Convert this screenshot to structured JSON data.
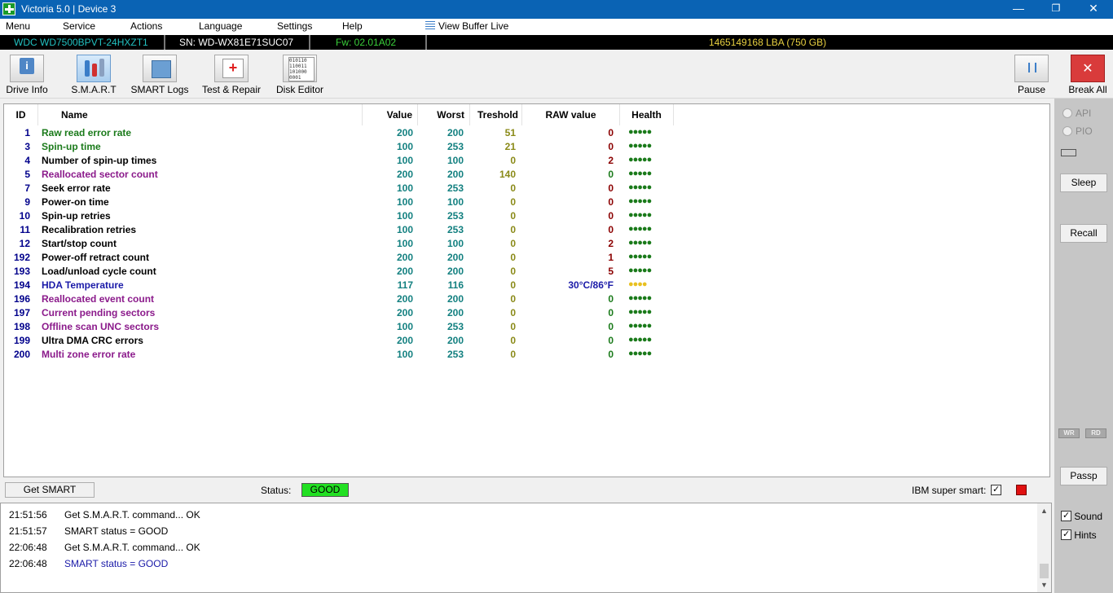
{
  "window": {
    "title": "Victoria 5.0 | Device 3",
    "min": "—",
    "max": "❐",
    "close": "✕"
  },
  "menu": {
    "items": [
      "Menu",
      "Service",
      "Actions",
      "Language",
      "Settings",
      "Help"
    ],
    "view_buffer": "View Buffer Live"
  },
  "drive": {
    "model": "WDC WD7500BPVT-24HXZT1",
    "serial": "SN: WD-WX81E71SUC07",
    "firmware": "Fw: 02.01A02",
    "capacity": "1465149168 LBA (750 GB)"
  },
  "toolbar": {
    "drive_info": "Drive Info",
    "smart": "S.M.A.R.T",
    "smart_logs": "SMART Logs",
    "test_repair": "Test & Repair",
    "disk_editor": "Disk Editor",
    "pause": "Pause",
    "break_all": "Break All"
  },
  "table": {
    "headers": {
      "id": "ID",
      "name": "Name",
      "value": "Value",
      "worst": "Worst",
      "threshold": "Treshold",
      "raw": "RAW value",
      "health": "Health"
    },
    "rows": [
      {
        "id": "1",
        "name": "Raw read error rate",
        "value": "200",
        "worst": "200",
        "threshold": "51",
        "raw": "0",
        "health": "●●●●●",
        "name_color": "#1a7a1a",
        "raw_color": "#8b0000",
        "health_color": "#1a7a1a"
      },
      {
        "id": "3",
        "name": "Spin-up time",
        "value": "100",
        "worst": "253",
        "threshold": "21",
        "raw": "0",
        "health": "●●●●●",
        "name_color": "#1a7a1a",
        "raw_color": "#8b0000",
        "health_color": "#1a7a1a"
      },
      {
        "id": "4",
        "name": "Number of spin-up times",
        "value": "100",
        "worst": "100",
        "threshold": "0",
        "raw": "2",
        "health": "●●●●●",
        "name_color": "#000000",
        "raw_color": "#8b0000",
        "health_color": "#1a7a1a"
      },
      {
        "id": "5",
        "name": "Reallocated sector count",
        "value": "200",
        "worst": "200",
        "threshold": "140",
        "raw": "0",
        "health": "●●●●●",
        "name_color": "#8b1a8b",
        "raw_color": "#1a7a1a",
        "health_color": "#1a7a1a"
      },
      {
        "id": "7",
        "name": "Seek error rate",
        "value": "100",
        "worst": "253",
        "threshold": "0",
        "raw": "0",
        "health": "●●●●●",
        "name_color": "#000000",
        "raw_color": "#8b0000",
        "health_color": "#1a7a1a"
      },
      {
        "id": "9",
        "name": "Power-on time",
        "value": "100",
        "worst": "100",
        "threshold": "0",
        "raw": "0",
        "health": "●●●●●",
        "name_color": "#000000",
        "raw_color": "#8b0000",
        "health_color": "#1a7a1a"
      },
      {
        "id": "10",
        "name": "Spin-up retries",
        "value": "100",
        "worst": "253",
        "threshold": "0",
        "raw": "0",
        "health": "●●●●●",
        "name_color": "#000000",
        "raw_color": "#8b0000",
        "health_color": "#1a7a1a"
      },
      {
        "id": "11",
        "name": "Recalibration retries",
        "value": "100",
        "worst": "253",
        "threshold": "0",
        "raw": "0",
        "health": "●●●●●",
        "name_color": "#000000",
        "raw_color": "#8b0000",
        "health_color": "#1a7a1a"
      },
      {
        "id": "12",
        "name": "Start/stop count",
        "value": "100",
        "worst": "100",
        "threshold": "0",
        "raw": "2",
        "health": "●●●●●",
        "name_color": "#000000",
        "raw_color": "#8b0000",
        "health_color": "#1a7a1a"
      },
      {
        "id": "192",
        "name": "Power-off retract count",
        "value": "200",
        "worst": "200",
        "threshold": "0",
        "raw": "1",
        "health": "●●●●●",
        "name_color": "#000000",
        "raw_color": "#8b0000",
        "health_color": "#1a7a1a"
      },
      {
        "id": "193",
        "name": "Load/unload cycle count",
        "value": "200",
        "worst": "200",
        "threshold": "0",
        "raw": "5",
        "health": "●●●●●",
        "name_color": "#000000",
        "raw_color": "#8b0000",
        "health_color": "#1a7a1a"
      },
      {
        "id": "194",
        "name": "HDA Temperature",
        "value": "117",
        "worst": "116",
        "threshold": "0",
        "raw": "30°C/86°F",
        "health": "●●●●",
        "name_color": "#1a1aa8",
        "raw_color": "#1a1aa8",
        "health_color": "#e8c020"
      },
      {
        "id": "196",
        "name": "Reallocated event count",
        "value": "200",
        "worst": "200",
        "threshold": "0",
        "raw": "0",
        "health": "●●●●●",
        "name_color": "#8b1a8b",
        "raw_color": "#1a7a1a",
        "health_color": "#1a7a1a"
      },
      {
        "id": "197",
        "name": "Current pending sectors",
        "value": "200",
        "worst": "200",
        "threshold": "0",
        "raw": "0",
        "health": "●●●●●",
        "name_color": "#8b1a8b",
        "raw_color": "#1a7a1a",
        "health_color": "#1a7a1a"
      },
      {
        "id": "198",
        "name": "Offline scan UNC sectors",
        "value": "100",
        "worst": "253",
        "threshold": "0",
        "raw": "0",
        "health": "●●●●●",
        "name_color": "#8b1a8b",
        "raw_color": "#1a7a1a",
        "health_color": "#1a7a1a"
      },
      {
        "id": "199",
        "name": "Ultra DMA CRC errors",
        "value": "200",
        "worst": "200",
        "threshold": "0",
        "raw": "0",
        "health": "●●●●●",
        "name_color": "#000000",
        "raw_color": "#1a7a1a",
        "health_color": "#1a7a1a"
      },
      {
        "id": "200",
        "name": "Multi zone error rate",
        "value": "100",
        "worst": "253",
        "threshold": "0",
        "raw": "0",
        "health": "●●●●●",
        "name_color": "#8b1a8b",
        "raw_color": "#1a7a1a",
        "health_color": "#1a7a1a"
      }
    ]
  },
  "sidebar": {
    "api": "API",
    "pio": "PIO",
    "sleep": "Sleep",
    "recall": "Recall",
    "wr": "WR",
    "rd": "RD",
    "passp": "Passp"
  },
  "status": {
    "get_smart": "Get SMART",
    "label": "Status:",
    "value": "GOOD",
    "ibm_label": "IBM super smart:"
  },
  "log": [
    {
      "time": "21:51:56",
      "msg": "Get S.M.A.R.T. command... OK",
      "color": "#000000"
    },
    {
      "time": "21:51:57",
      "msg": "SMART status = GOOD",
      "color": "#000000"
    },
    {
      "time": "22:06:48",
      "msg": "Get S.M.A.R.T. command... OK",
      "color": "#000000"
    },
    {
      "time": "22:06:48",
      "msg": "SMART status = GOOD",
      "color": "#1a1aa8"
    }
  ],
  "options": {
    "sound": "Sound",
    "hints": "Hints"
  },
  "colors": {
    "titlebar": "#0a63b4",
    "model": "#22c0c0",
    "firmware": "#3ad03a",
    "capacity": "#e8d040",
    "good": "#22e022",
    "indicator": "#e01010"
  }
}
